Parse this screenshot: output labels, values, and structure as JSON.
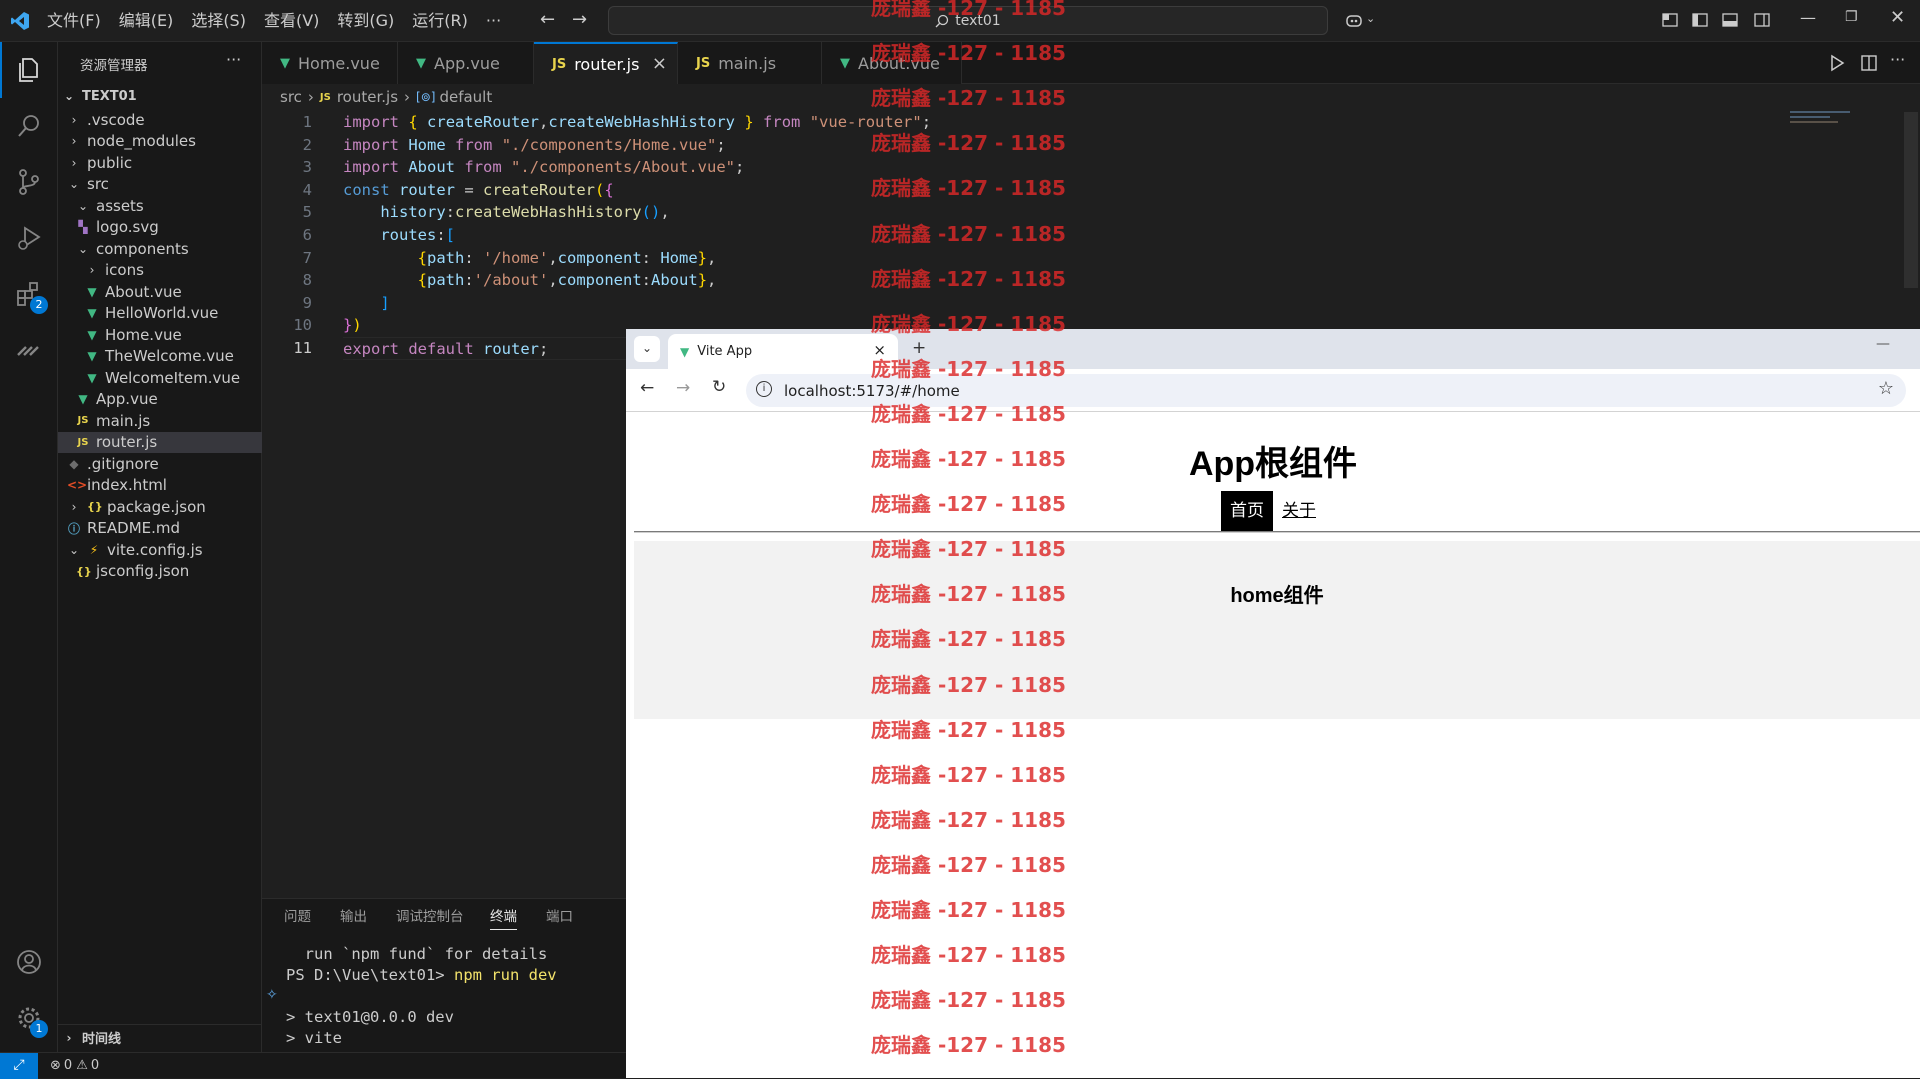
{
  "titlebar": {
    "menus": [
      "文件(F)",
      "编辑(E)",
      "选择(S)",
      "查看(V)",
      "转到(G)",
      "运行(R)",
      "···"
    ],
    "search": "text01"
  },
  "activitybar": {
    "extensions_badge": "2",
    "settings_badge": "1"
  },
  "sidebar": {
    "title": "资源管理器",
    "more": "···",
    "project": "TEXT01",
    "items": [
      {
        "label": ".vscode",
        "chevron": "›",
        "icon": ""
      },
      {
        "label": "node_modules",
        "chevron": "›",
        "icon": ""
      },
      {
        "label": "public",
        "chevron": "›",
        "icon": ""
      },
      {
        "label": "src",
        "chevron": "⌄",
        "icon": ""
      },
      {
        "label": "assets",
        "chevron": "⌄",
        "icon": ""
      },
      {
        "label": "logo.svg",
        "chevron": "",
        "icon": "svg"
      },
      {
        "label": "components",
        "chevron": "⌄",
        "icon": ""
      },
      {
        "label": "icons",
        "chevron": "›",
        "icon": ""
      },
      {
        "label": "About.vue",
        "chevron": "",
        "icon": "vue"
      },
      {
        "label": "HelloWorld.vue",
        "chevron": "",
        "icon": "vue"
      },
      {
        "label": "Home.vue",
        "chevron": "",
        "icon": "vue"
      },
      {
        "label": "TheWelcome.vue",
        "chevron": "",
        "icon": "vue"
      },
      {
        "label": "WelcomeItem.vue",
        "chevron": "",
        "icon": "vue"
      },
      {
        "label": "App.vue",
        "chevron": "",
        "icon": "vue"
      },
      {
        "label": "main.js",
        "chevron": "",
        "icon": "js"
      },
      {
        "label": "router.js",
        "chevron": "",
        "icon": "js"
      },
      {
        "label": ".gitignore",
        "chevron": "",
        "icon": "git"
      },
      {
        "label": "index.html",
        "chevron": "",
        "icon": "html"
      },
      {
        "label": "package.json",
        "chevron": "›",
        "icon": "json"
      },
      {
        "label": "README.md",
        "chevron": "",
        "icon": "info"
      },
      {
        "label": "vite.config.js",
        "chevron": "⌄",
        "icon": "vite"
      },
      {
        "label": "jsconfig.json",
        "chevron": "",
        "icon": "json"
      }
    ],
    "timeline": "时间线"
  },
  "tabs": [
    {
      "label": "Home.vue",
      "icon": "vue"
    },
    {
      "label": "App.vue",
      "icon": "vue"
    },
    {
      "label": "router.js",
      "icon": "js",
      "close": "×"
    },
    {
      "label": "main.js",
      "icon": "js"
    },
    {
      "label": "About.vue",
      "icon": "vue"
    }
  ],
  "breadcrumb": {
    "folder": "src",
    "file": "router.js",
    "symbol": "default"
  },
  "editor": {
    "line_numbers": [
      "1",
      "2",
      "3",
      "4",
      "5",
      "6",
      "7",
      "8",
      "9",
      "10",
      "11"
    ]
  },
  "panel": {
    "tabs": [
      "问题",
      "输出",
      "调试控制台",
      "终端",
      "端口"
    ],
    "terminal": [
      "  run `npm fund` for details",
      "PS D:\\Vue\\text01> ",
      "npm run dev",
      "> text01@0.0.0 dev",
      "> vite"
    ]
  },
  "statusbar": {
    "errors": "0",
    "warnings": "0"
  },
  "browser": {
    "tab_title": "Vite App",
    "tab_close": "×",
    "new_tab": "+",
    "url": "localhost:5173/#/home",
    "app_title": "App根组件",
    "nav": [
      "首页",
      "关于"
    ],
    "home_text": "home组件"
  },
  "watermark": "庞瑞鑫 -127 - 1185"
}
